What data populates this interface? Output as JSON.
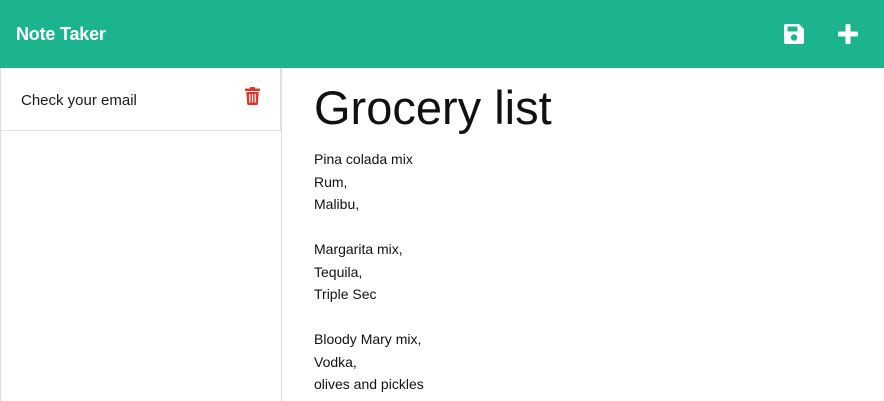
{
  "app": {
    "title": "Note Taker"
  },
  "colors": {
    "nav_bg": "#1bb48f",
    "nav_icon": "#ffffff",
    "delete_icon": "#e0352b"
  },
  "toolbar": {
    "save_icon": "floppy-disk-icon",
    "new_icon": "plus-icon"
  },
  "sidebar": {
    "notes": [
      {
        "title": "Check your email",
        "delete_icon": "trash-icon"
      }
    ]
  },
  "editor": {
    "title": "Grocery list",
    "body": "Pina colada mix\nRum,\nMalibu,\n\nMargarita mix,\nTequila,\nTriple Sec\n\nBloody Mary mix,\nVodka,\nolives and pickles"
  }
}
